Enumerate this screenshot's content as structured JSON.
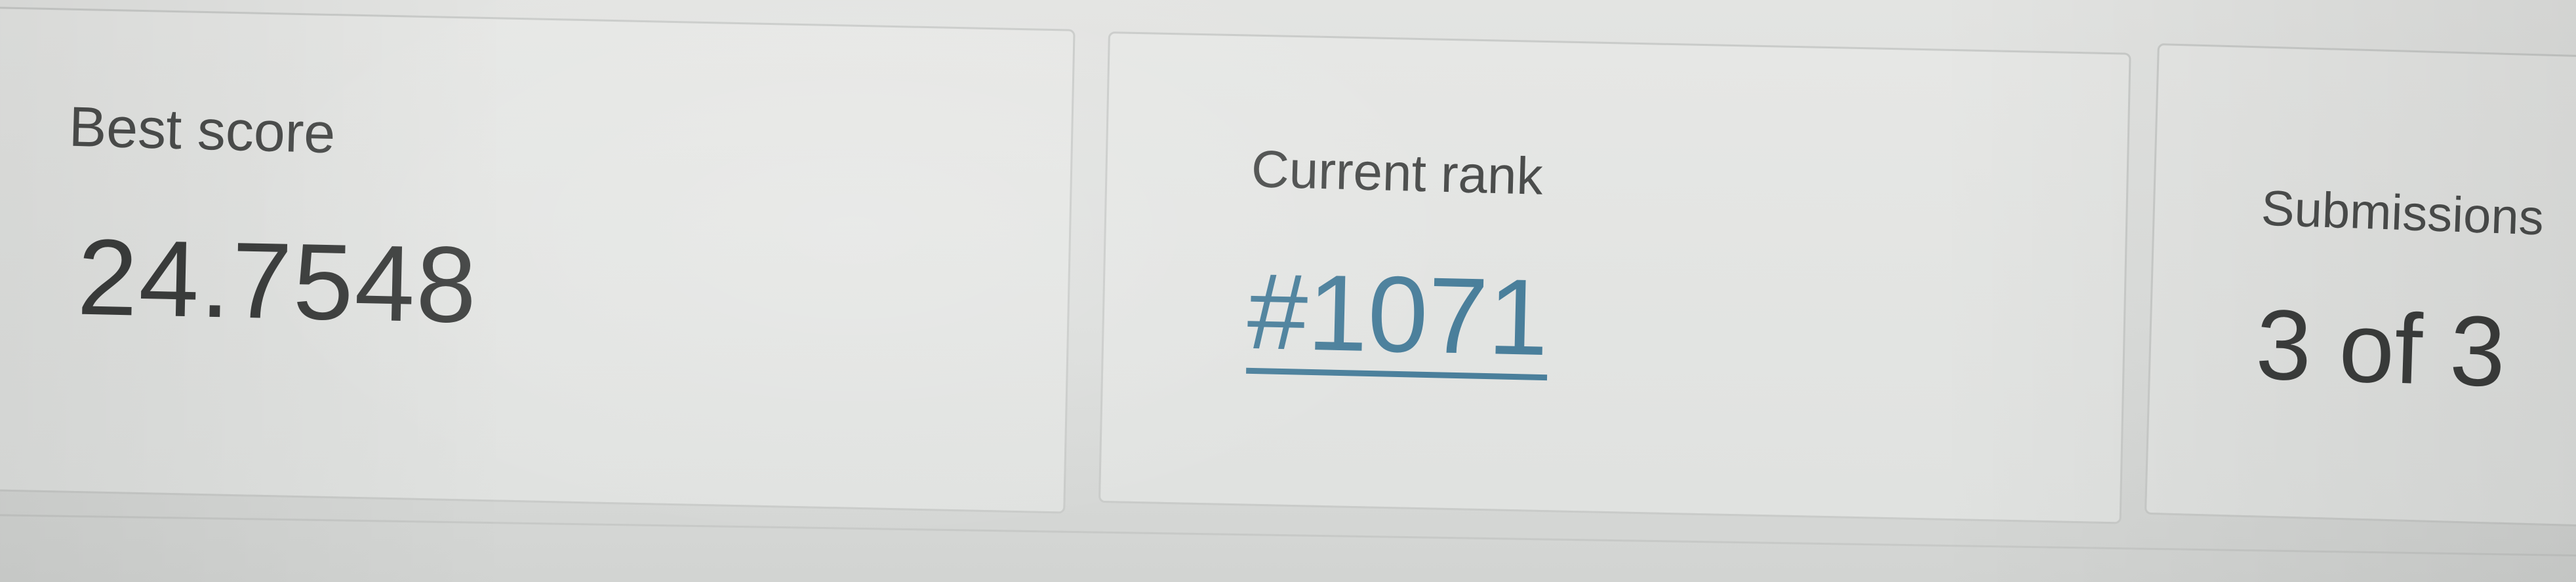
{
  "stats": {
    "best_score": {
      "label": "Best score",
      "value": "24.7548"
    },
    "current_rank": {
      "label": "Current rank",
      "value": "#1071"
    },
    "submissions": {
      "label": "Submissions",
      "value": "3 of 3"
    }
  },
  "colors": {
    "link": "#4a7f9b",
    "text": "#3b3d3c",
    "card_background": "#e3e4e2"
  }
}
